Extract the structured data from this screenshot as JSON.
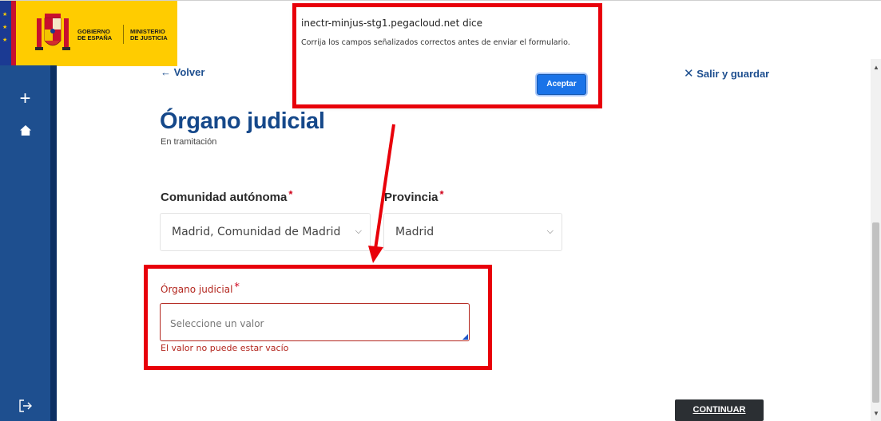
{
  "header": {
    "gov_line1": "GOBIERNO",
    "gov_line2": "DE ESPAÑA",
    "min_line1": "MINISTERIO",
    "min_line2": "DE JUSTICIA"
  },
  "sidebar": {
    "icons": [
      "plus-icon",
      "home-icon",
      "exit-icon"
    ]
  },
  "nav": {
    "back_label": "← Volver",
    "exit_save_label": "Salir y guardar"
  },
  "page": {
    "title": "Órgano judicial",
    "subtitle": "En tramitación"
  },
  "form": {
    "comunidad_label": "Comunidad autónoma",
    "comunidad_value": "Madrid, Comunidad de Madrid",
    "provincia_label": "Provincia",
    "provincia_value": "Madrid",
    "organo_label": "Órgano judicial",
    "organo_placeholder": "Seleccione un valor",
    "organo_error": "El valor no puede estar vacío",
    "required_mark": "*",
    "continue_label": "CONTINUAR"
  },
  "dialog": {
    "title": "inectr-minjus-stg1.pegacloud.net dice",
    "message": "Corrija los campos señalizados correctos antes de enviar el formulario.",
    "accept_label": "Aceptar"
  },
  "colors": {
    "sidebar": "#1e4f8f",
    "brand_blue": "#15488a",
    "error_red": "#b3261e",
    "annotation_red": "#e8000a",
    "gov_yellow": "#ffcc00"
  }
}
